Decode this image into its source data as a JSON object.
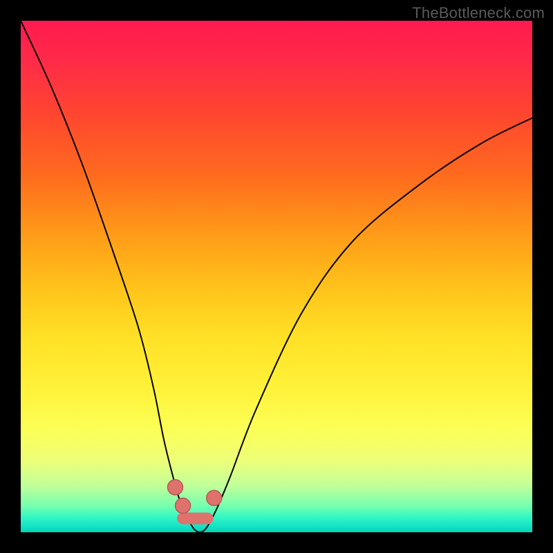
{
  "watermark": "TheBottleneck.com",
  "colors": {
    "gradient_top": "#ff1a50",
    "gradient_bottom": "#00d4b4",
    "curve": "#000000",
    "marker_fill": "#e0726e",
    "marker_stroke": "#b35a56",
    "frame": "#000000"
  },
  "chart_data": {
    "type": "line",
    "title": "",
    "xlabel": "",
    "ylabel": "",
    "xlim": [
      0,
      100
    ],
    "ylim": [
      0,
      100
    ],
    "grid": false,
    "legend": false,
    "notes": "Curve depicts a bottleneck-style V: steep descent from top-left to a narrow minimum near x≈31–37, then a slower concave rise to the right edge. Y-axis maps to vertical gradient: low y (green) at bottom = good, high y (red) at top = bad. No axis ticks or labels are present in the image; x/y values are estimated from pixel positions.",
    "series": [
      {
        "name": "curve",
        "x": [
          0,
          6,
          12,
          18,
          23,
          26,
          28,
          30,
          31.5,
          33,
          34,
          35,
          36,
          37,
          38.5,
          41,
          46,
          55,
          65,
          78,
          90,
          100
        ],
        "y": [
          100,
          87,
          72,
          55,
          40,
          28,
          18,
          10,
          5,
          2,
          0.5,
          0,
          0.5,
          2,
          5,
          11,
          24,
          43,
          57,
          68,
          76,
          81
        ]
      }
    ],
    "markers": [
      {
        "x": 30.2,
        "y": 8.8,
        "r": 11
      },
      {
        "x": 31.7,
        "y": 5.2,
        "r": 11
      },
      {
        "x": 37.8,
        "y": 6.7,
        "r": 11
      }
    ],
    "valley_bridge": {
      "x1": 31.7,
      "y1": 2.7,
      "x2": 36.5,
      "y2": 2.7
    }
  }
}
